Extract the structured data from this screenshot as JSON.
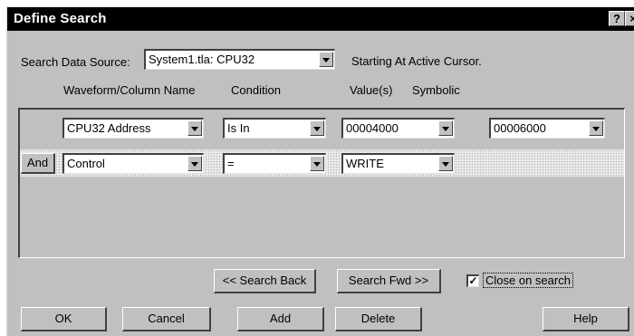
{
  "window": {
    "title": "Define Search",
    "help_glyph": "?",
    "close_glyph": "×"
  },
  "source": {
    "label": "Search Data Source:",
    "value": "System1.tla: CPU32",
    "start_text": "Starting At Active Cursor."
  },
  "columns": {
    "waveform": "Waveform/Column Name",
    "condition": "Condition",
    "values": "Value(s)",
    "symbolic": "Symbolic"
  },
  "rows": [
    {
      "connector": "",
      "name": "CPU32 Address",
      "condition": "Is In",
      "value": "00004000",
      "value2": "00006000"
    },
    {
      "connector": "And",
      "name": "Control",
      "condition": "=",
      "value": "WRITE"
    }
  ],
  "actions": {
    "search_back": "<< Search Back",
    "search_fwd": "Search Fwd >>",
    "close_on_search": "Close on search",
    "close_on_search_checked": true
  },
  "buttons": {
    "ok": "OK",
    "cancel": "Cancel",
    "add": "Add",
    "delete": "Delete",
    "help": "Help"
  },
  "icons": {
    "dropdown": "chevron-down-icon",
    "check": "checkmark-icon"
  }
}
